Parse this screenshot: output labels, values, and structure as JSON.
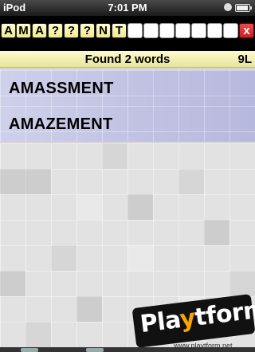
{
  "status_bar": {
    "carrier": "iPod",
    "time": "7:01 PM"
  },
  "pattern": {
    "letters": [
      "A",
      "M",
      "A",
      "?",
      "?",
      "?",
      "N",
      "T",
      "",
      "",
      "",
      "",
      "",
      ""
    ],
    "close_label": "x"
  },
  "found_bar": {
    "label": "Found 2 words",
    "length": "9L"
  },
  "results": [
    {
      "word": "AMASSMENT"
    },
    {
      "word": "AMAZEMENT"
    }
  ],
  "watermark": {
    "logo": "Playtform",
    "url": "www.playtform.net"
  },
  "colors": {
    "tile": "#f6efa8",
    "close": "#d62828",
    "result_bg": "#c2c3e3",
    "found_bg": "#f4efb4"
  }
}
